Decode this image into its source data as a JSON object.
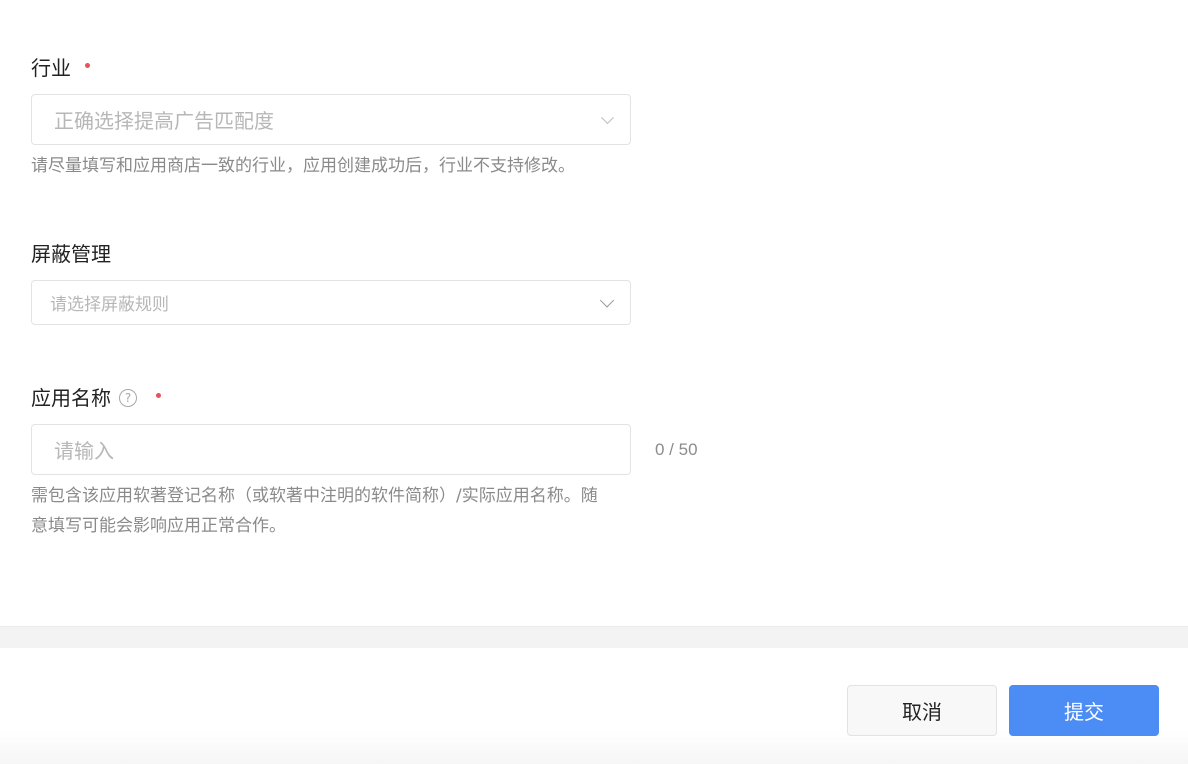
{
  "form": {
    "industry": {
      "label": "行业",
      "placeholder": "正确选择提高广告匹配度",
      "hint": "请尽量填写和应用商店一致的行业，应用创建成功后，行业不支持修改。"
    },
    "shield": {
      "label": "屏蔽管理",
      "placeholder": "请选择屏蔽规则"
    },
    "app_name": {
      "label": "应用名称",
      "help_icon": "?",
      "placeholder": "请输入",
      "counter": "0 / 50",
      "hint_line1": "需包含该应用软著登记名称（或软著中注明的软件简称）/实际应用名称。随",
      "hint_line2": "意填写可能会影响应用正常合作。"
    }
  },
  "footer": {
    "cancel_label": "取消",
    "submit_label": "提交"
  },
  "colors": {
    "required_dot": "#e3545b",
    "primary": "#4b8cf5"
  }
}
